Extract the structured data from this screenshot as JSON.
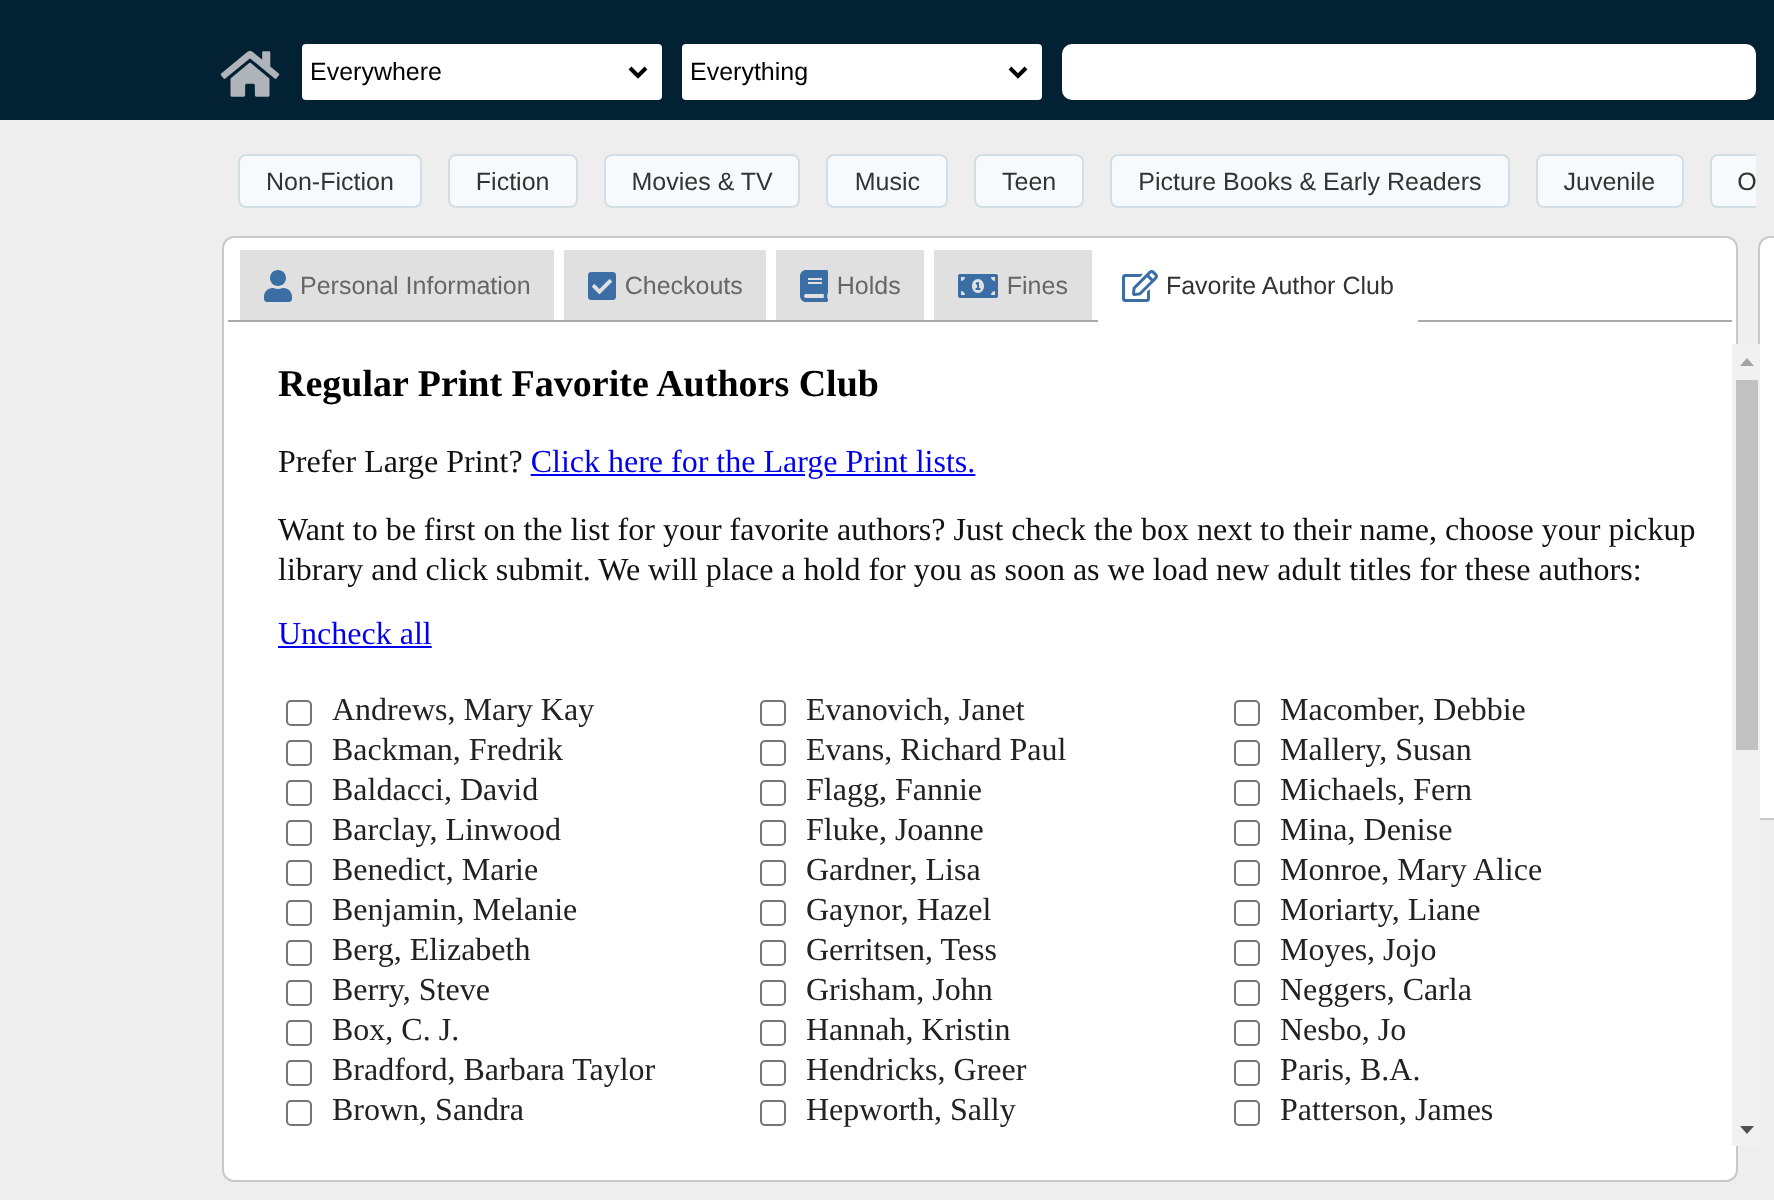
{
  "header": {
    "scope_select": {
      "value": "Everywhere"
    },
    "format_select": {
      "value": "Everything"
    }
  },
  "categories": [
    "Non-Fiction",
    "Fiction",
    "Movies & TV",
    "Music",
    "Teen",
    "Picture Books & Early Readers",
    "Juvenile",
    "O"
  ],
  "tabs": [
    {
      "label": "Personal Information",
      "selected": false
    },
    {
      "label": "Checkouts",
      "selected": false
    },
    {
      "label": "Holds",
      "selected": false
    },
    {
      "label": "Fines",
      "selected": false
    },
    {
      "label": "Favorite Author Club",
      "selected": true
    }
  ],
  "favorite_authors": {
    "heading": "Regular Print Favorite Authors Club",
    "large_print_prompt": {
      "text": "Prefer Large Print?",
      "link": "Click here for the Large Print lists."
    },
    "description": "Want to be first on the list for your favorite authors? Just check the box next to their name, choose your pickup library and click submit. We will place a hold for you as soon as we load new adult titles for these authors:",
    "uncheck_all_link": "Uncheck all",
    "author_columns": [
      {
        "authors": [
          {
            "name": "Andrews, Mary Kay",
            "checked": false
          },
          {
            "name": "Backman, Fredrik",
            "checked": false
          },
          {
            "name": "Baldacci, David",
            "checked": false
          },
          {
            "name": "Barclay, Linwood",
            "checked": false
          },
          {
            "name": "Benedict, Marie",
            "checked": false
          },
          {
            "name": "Benjamin, Melanie",
            "checked": false
          },
          {
            "name": "Berg, Elizabeth",
            "checked": false
          },
          {
            "name": "Berry, Steve",
            "checked": false
          },
          {
            "name": "Box, C. J.",
            "checked": false
          },
          {
            "name": "Bradford, Barbara Taylor",
            "checked": false
          },
          {
            "name": "Brown, Sandra",
            "checked": false
          }
        ]
      },
      {
        "authors": [
          {
            "name": "Evanovich, Janet",
            "checked": false
          },
          {
            "name": "Evans, Richard Paul",
            "checked": false
          },
          {
            "name": "Flagg, Fannie",
            "checked": false
          },
          {
            "name": "Fluke, Joanne",
            "checked": false
          },
          {
            "name": "Gardner, Lisa",
            "checked": false
          },
          {
            "name": "Gaynor, Hazel",
            "checked": false
          },
          {
            "name": "Gerritsen, Tess",
            "checked": false
          },
          {
            "name": "Grisham, John",
            "checked": false
          },
          {
            "name": "Hannah, Kristin",
            "checked": false
          },
          {
            "name": "Hendricks, Greer",
            "checked": false
          },
          {
            "name": "Hepworth, Sally",
            "checked": false
          }
        ]
      },
      {
        "authors": [
          {
            "name": "Macomber, Debbie",
            "checked": false
          },
          {
            "name": "Mallery, Susan",
            "checked": false
          },
          {
            "name": "Michaels, Fern",
            "checked": false
          },
          {
            "name": "Mina, Denise",
            "checked": false
          },
          {
            "name": "Monroe, Mary Alice",
            "checked": false
          },
          {
            "name": "Moriarty, Liane",
            "checked": false
          },
          {
            "name": "Moyes, Jojo",
            "checked": false
          },
          {
            "name": "Neggers, Carla",
            "checked": false
          },
          {
            "name": "Nesbo, Jo",
            "checked": false
          },
          {
            "name": "Paris, B.A.",
            "checked": false
          },
          {
            "name": "Patterson, James",
            "checked": false
          }
        ]
      }
    ]
  }
}
